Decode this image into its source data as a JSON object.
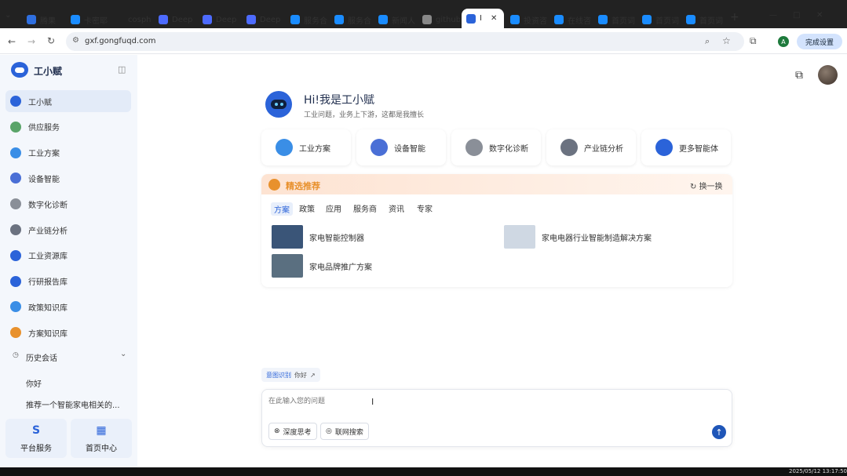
{
  "browser": {
    "tabs": [
      {
        "label": "腾果",
        "color": "#2f6fe0"
      },
      {
        "label": "卡密耶",
        "color": "#1a8cff"
      },
      {
        "label": "cosph",
        "color": "#222222"
      },
      {
        "label": "Deep",
        "color": "#4d6bfe"
      },
      {
        "label": "Deep",
        "color": "#4d6bfe"
      },
      {
        "label": "Deep",
        "color": "#4d6bfe"
      },
      {
        "label": "服务合",
        "color": "#1a8cff"
      },
      {
        "label": "服务合",
        "color": "#1a8cff"
      },
      {
        "label": "新闻人",
        "color": "#1a8cff"
      },
      {
        "label": "github",
        "color": "#888888"
      },
      {
        "label": "I",
        "color": "#2b63d9",
        "active": true
      },
      {
        "label": "投资咨",
        "color": "#1a8cff"
      },
      {
        "label": "在线咨",
        "color": "#1a8cff"
      },
      {
        "label": "首页词",
        "color": "#1a8cff"
      },
      {
        "label": "首页词",
        "color": "#1a8cff"
      },
      {
        "label": "首页词",
        "color": "#1a8cff"
      }
    ],
    "url": "gxf.gongfuqd.com",
    "profile_button": "完成设置",
    "profile_initial": "A"
  },
  "sidebar": {
    "brand": "工小赋",
    "items": [
      {
        "label": "工小赋",
        "color": "#2b63d9"
      },
      {
        "label": "供应服务",
        "color": "#5aa469"
      },
      {
        "label": "工业方案",
        "color": "#3a8ee6"
      },
      {
        "label": "设备智能",
        "color": "#4a6fd6"
      },
      {
        "label": "数字化诊断",
        "color": "#8a8f98"
      },
      {
        "label": "产业链分析",
        "color": "#6b7280"
      },
      {
        "label": "工业资源库",
        "color": "#2b63d9"
      },
      {
        "label": "行研报告库",
        "color": "#2b63d9"
      },
      {
        "label": "政策知识库",
        "color": "#3a8ee6"
      },
      {
        "label": "方案知识库",
        "color": "#e8912d"
      }
    ],
    "history_header": "历史会话",
    "history": [
      "你好",
      "推荐一个智能家电相关的..."
    ],
    "bottom": [
      {
        "label": "平台服务",
        "icon": "service-icon"
      },
      {
        "label": "首页中心",
        "icon": "grid-icon"
      }
    ]
  },
  "greeting": {
    "title": "Hi!我是工小赋",
    "subtitle": "工业问题，业务上下游，这都是我擅长"
  },
  "quick_actions": [
    {
      "label": "工业方案",
      "color": "#3a8ee6"
    },
    {
      "label": "设备智能",
      "color": "#4a6fd6"
    },
    {
      "label": "数字化诊断",
      "color": "#8a8f98"
    },
    {
      "label": "产业链分析",
      "color": "#6b7280"
    },
    {
      "label": "更多智能体",
      "color": "#2b63d9"
    }
  ],
  "recommend": {
    "title": "精选推荐",
    "refresh": "换一换",
    "tabs": [
      "方案",
      "政策",
      "应用",
      "服务商",
      "资讯",
      "专家"
    ],
    "active_tab": 0,
    "items": [
      {
        "title": "家电智能控制器",
        "thumb": "#3a5578"
      },
      {
        "title": "家电电器行业智能制造解决方案",
        "thumb": "#cfd8e3"
      },
      {
        "title": "家电品牌推广方案",
        "thumb": "#5a6f80"
      }
    ]
  },
  "input": {
    "prefix_tag": "意图识别",
    "prefix_value": "你好",
    "placeholder": "在此输入您的问题",
    "deep_think": "深度思考",
    "web_search": "联网搜索"
  },
  "taskbar_time": "2025/05/12 13:17:50",
  "colors": {
    "accent": "#2b63d9",
    "orange": "#e8912d"
  }
}
